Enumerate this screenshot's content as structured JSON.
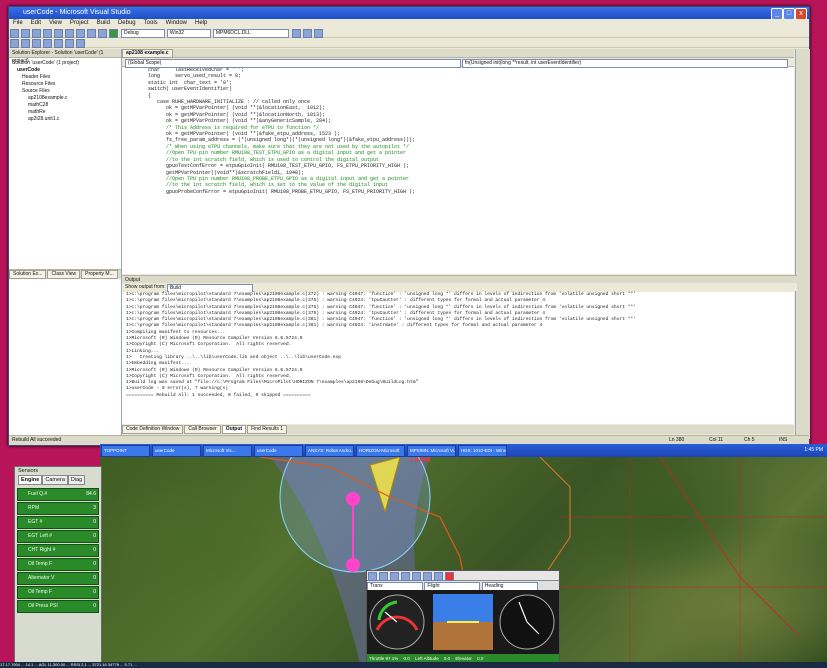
{
  "vs": {
    "title": "userCode - Microsoft Visual Studio",
    "menu": [
      "File",
      "Edit",
      "View",
      "Project",
      "Build",
      "Debug",
      "Tools",
      "Window",
      "Help"
    ],
    "config_combo": "Debug",
    "platform_combo": "Win32",
    "target_combo": "MPM6DCL.DLL",
    "solution_explorer": {
      "header": "Solution Explorer - Solution 'userCode' (1 project)",
      "items": [
        "Solution 'userCode' (1 project)",
        "userCode",
        "Header Files",
        "Resource Files",
        "Source Files",
        "ap2108example.c",
        "mathC28",
        "mathRe",
        "ap2t28.unit1.c"
      ],
      "tabs": [
        "Solution Ex...",
        "Class View",
        "Property M..."
      ]
    },
    "editor": {
      "tab": "ap2108 example.c",
      "scope_left": "(Global Scope)",
      "scope_right": "fn(Unsigned init(long **result, int userEventIdentifier)",
      "lines": [
        "    char     lastReceivedChar = ' ';",
        "    long     servo_used_result = 0;",
        "    static int  char_text = '0';",
        "",
        "    switch( userEventIdentifier)",
        "    {",
        "       case RUHE_HARDWARE_INITIALIZE : // called only once",
        "",
        "          ok = getMPVarPointer( (void **)&locationEast,  1012);",
        "          ok = getMPVarPointer( (void **)&locationNorth, 1013);",
        "          ok = getMPVarPointer( (void **)&anyGenericSample, 284);",
        "",
        "          /* This Address is required for eTPU to function */",
        "          ok = getMPVarPointer( (void **)&fake_etpu_address, 1523 );",
        "          fs_free_param_address = (*(unsigned long*)(*(unsigned long*)(&fake_etpu_address)));",
        "",
        "",
        "          /* When using eTPU channels, make sure that they are not used by the autopilot */",
        "",
        "          //Open TPU pin number RMU108_TEST_ETPU_GPIO as a digital input and get a pointer",
        "          //to the int scratch field, which is used to control the digital output",
        "          gpuoTestConfError = etpuGpioInit( RMU108_TEST_ETPU_GPIO, FS_ETPU_PRIORITY_HIGH );",
        "          getMPVarPointer((void**)&scratchField1, 1940);",
        "",
        "          //Open TPU pin number RMU108_PROBE_ETPU_GPIO as a digital input and get a pointer",
        "          //to the int scratch field, which is set to the value of the digital input",
        "          gpuoProbeConfError = etpuGpioInit( RMU108_PROBE_ETPU_GPIO, FS_ETPU_PRIORITY_HIGH );"
      ]
    },
    "output": {
      "title": "Output",
      "show_label": "Show output from:",
      "show_value": "Build",
      "lines": [
        "1>c:\\program files\\micropilot\\standard 7\\examples\\ap2108example.c(372) : warning C4047: 'function' : 'unsigned long *' differs in levels of indirection from 'volatile unsigned short **'",
        "1>c:\\program files\\micropilot\\standard 7\\examples\\ap2108example.c(375) : warning C4024: 'tpuCautter' : different types for formal and actual parameter 4",
        "1>c:\\program files\\micropilot\\standard 7\\examples\\ap2108example.c(375) : warning C4047: 'function' : 'unsigned long *' differs in levels of indirection from 'volatile unsigned short **'",
        "1>c:\\program files\\micropilot\\standard 7\\examples\\ap2108example.c(375) : warning C4024: 'tpuCautter' : different types for formal and actual parameter 4",
        "1>c:\\program files\\micropilot\\standard 7\\examples\\ap2108example.c(381) : warning C4047: 'function' : 'unsigned long *' differs in levels of indirection from 'volatile unsigned short **'",
        "1>c:\\program files\\micropilot\\standard 7\\examples\\ap2108example.c(381) : warning C4024: 'instrmate' : different types for formal and actual parameter 4",
        "1>Compiling manifest to resources...",
        "1>Microsoft (R) Windows (R) Resource Compiler Version 6.0.5724.0",
        "1>Copyright (C) Microsoft Corporation.  All rights reserved.",
        "1>Linking...",
        "1>   Creating library ..\\..\\lib\\userCode.lib and object ..\\..\\lib\\userCode.exp",
        "1>Embedding manifest...",
        "1>Microsoft (R) Windows (R) Resource Compiler Version 6.0.5724.0",
        "1>Copyright (C) Microsoft Corporation.  All rights reserved.",
        "1>Build log was saved at \"file://c:\\Program Files\\MicroPilot\\HORIZON 7\\examples\\ap2108\\Debug\\BuildLog.htm\"",
        "1>userCode - 0 error(s), 7 warning(s)",
        "========== Rebuild All: 1 succeeded, 0 failed, 0 skipped =========="
      ]
    },
    "bottom_tabs": [
      "Code Definition Window",
      "Call Browser",
      "Output",
      "Find Results 1"
    ],
    "status": {
      "left": "Rebuild All succeeded",
      "ln": "Ln 380",
      "col": "Col 11",
      "ch": "Ch 5",
      "ins": "INS"
    }
  },
  "taskbar": {
    "items": [
      "TOPPOINT",
      "userCode",
      "Microsoft Vis...",
      "userCode",
      "ANSYS: Robot Andro...",
      "HORIZON-Microsoft",
      "MPSIMN: Microsoft Vi...",
      "HDS: 1010-EDI - Wins..."
    ],
    "clock": "1:45 PM"
  },
  "gcs": {
    "section": "Sensors",
    "tabs": [
      "Engine",
      "Camera",
      "Diag"
    ],
    "gauges": [
      {
        "label": "Fuel Q.#",
        "value": "84.6"
      },
      {
        "label": "RPM",
        "value": "3"
      },
      {
        "label": "EGT #",
        "value": "0"
      },
      {
        "label": "EGT Left #",
        "value": "0"
      },
      {
        "label": "CHT Right #",
        "value": "0"
      },
      {
        "label": "Oil Temp F",
        "value": "0"
      },
      {
        "label": "Alternator V",
        "value": "0"
      },
      {
        "label": "Oil Temp F",
        "value": "0"
      },
      {
        "label": "Oil Press PSI",
        "value": "0"
      }
    ]
  },
  "map": {
    "vehicle_label": "7.27SM"
  },
  "instruments": {
    "toolbar": [
      "Trans",
      "Flight",
      "Heading"
    ],
    "readouts": [
      "Throttle 97.1%",
      "0.0",
      "Left Altitude",
      "0.0",
      "Elevator",
      "0.0"
    ]
  },
  "bottom_strip": "17.17.7604 ... 14.1 ... AGL 11,300.00 ... RSSI 2.1 ... 3721.16 3477ft ... 5.71 ..."
}
